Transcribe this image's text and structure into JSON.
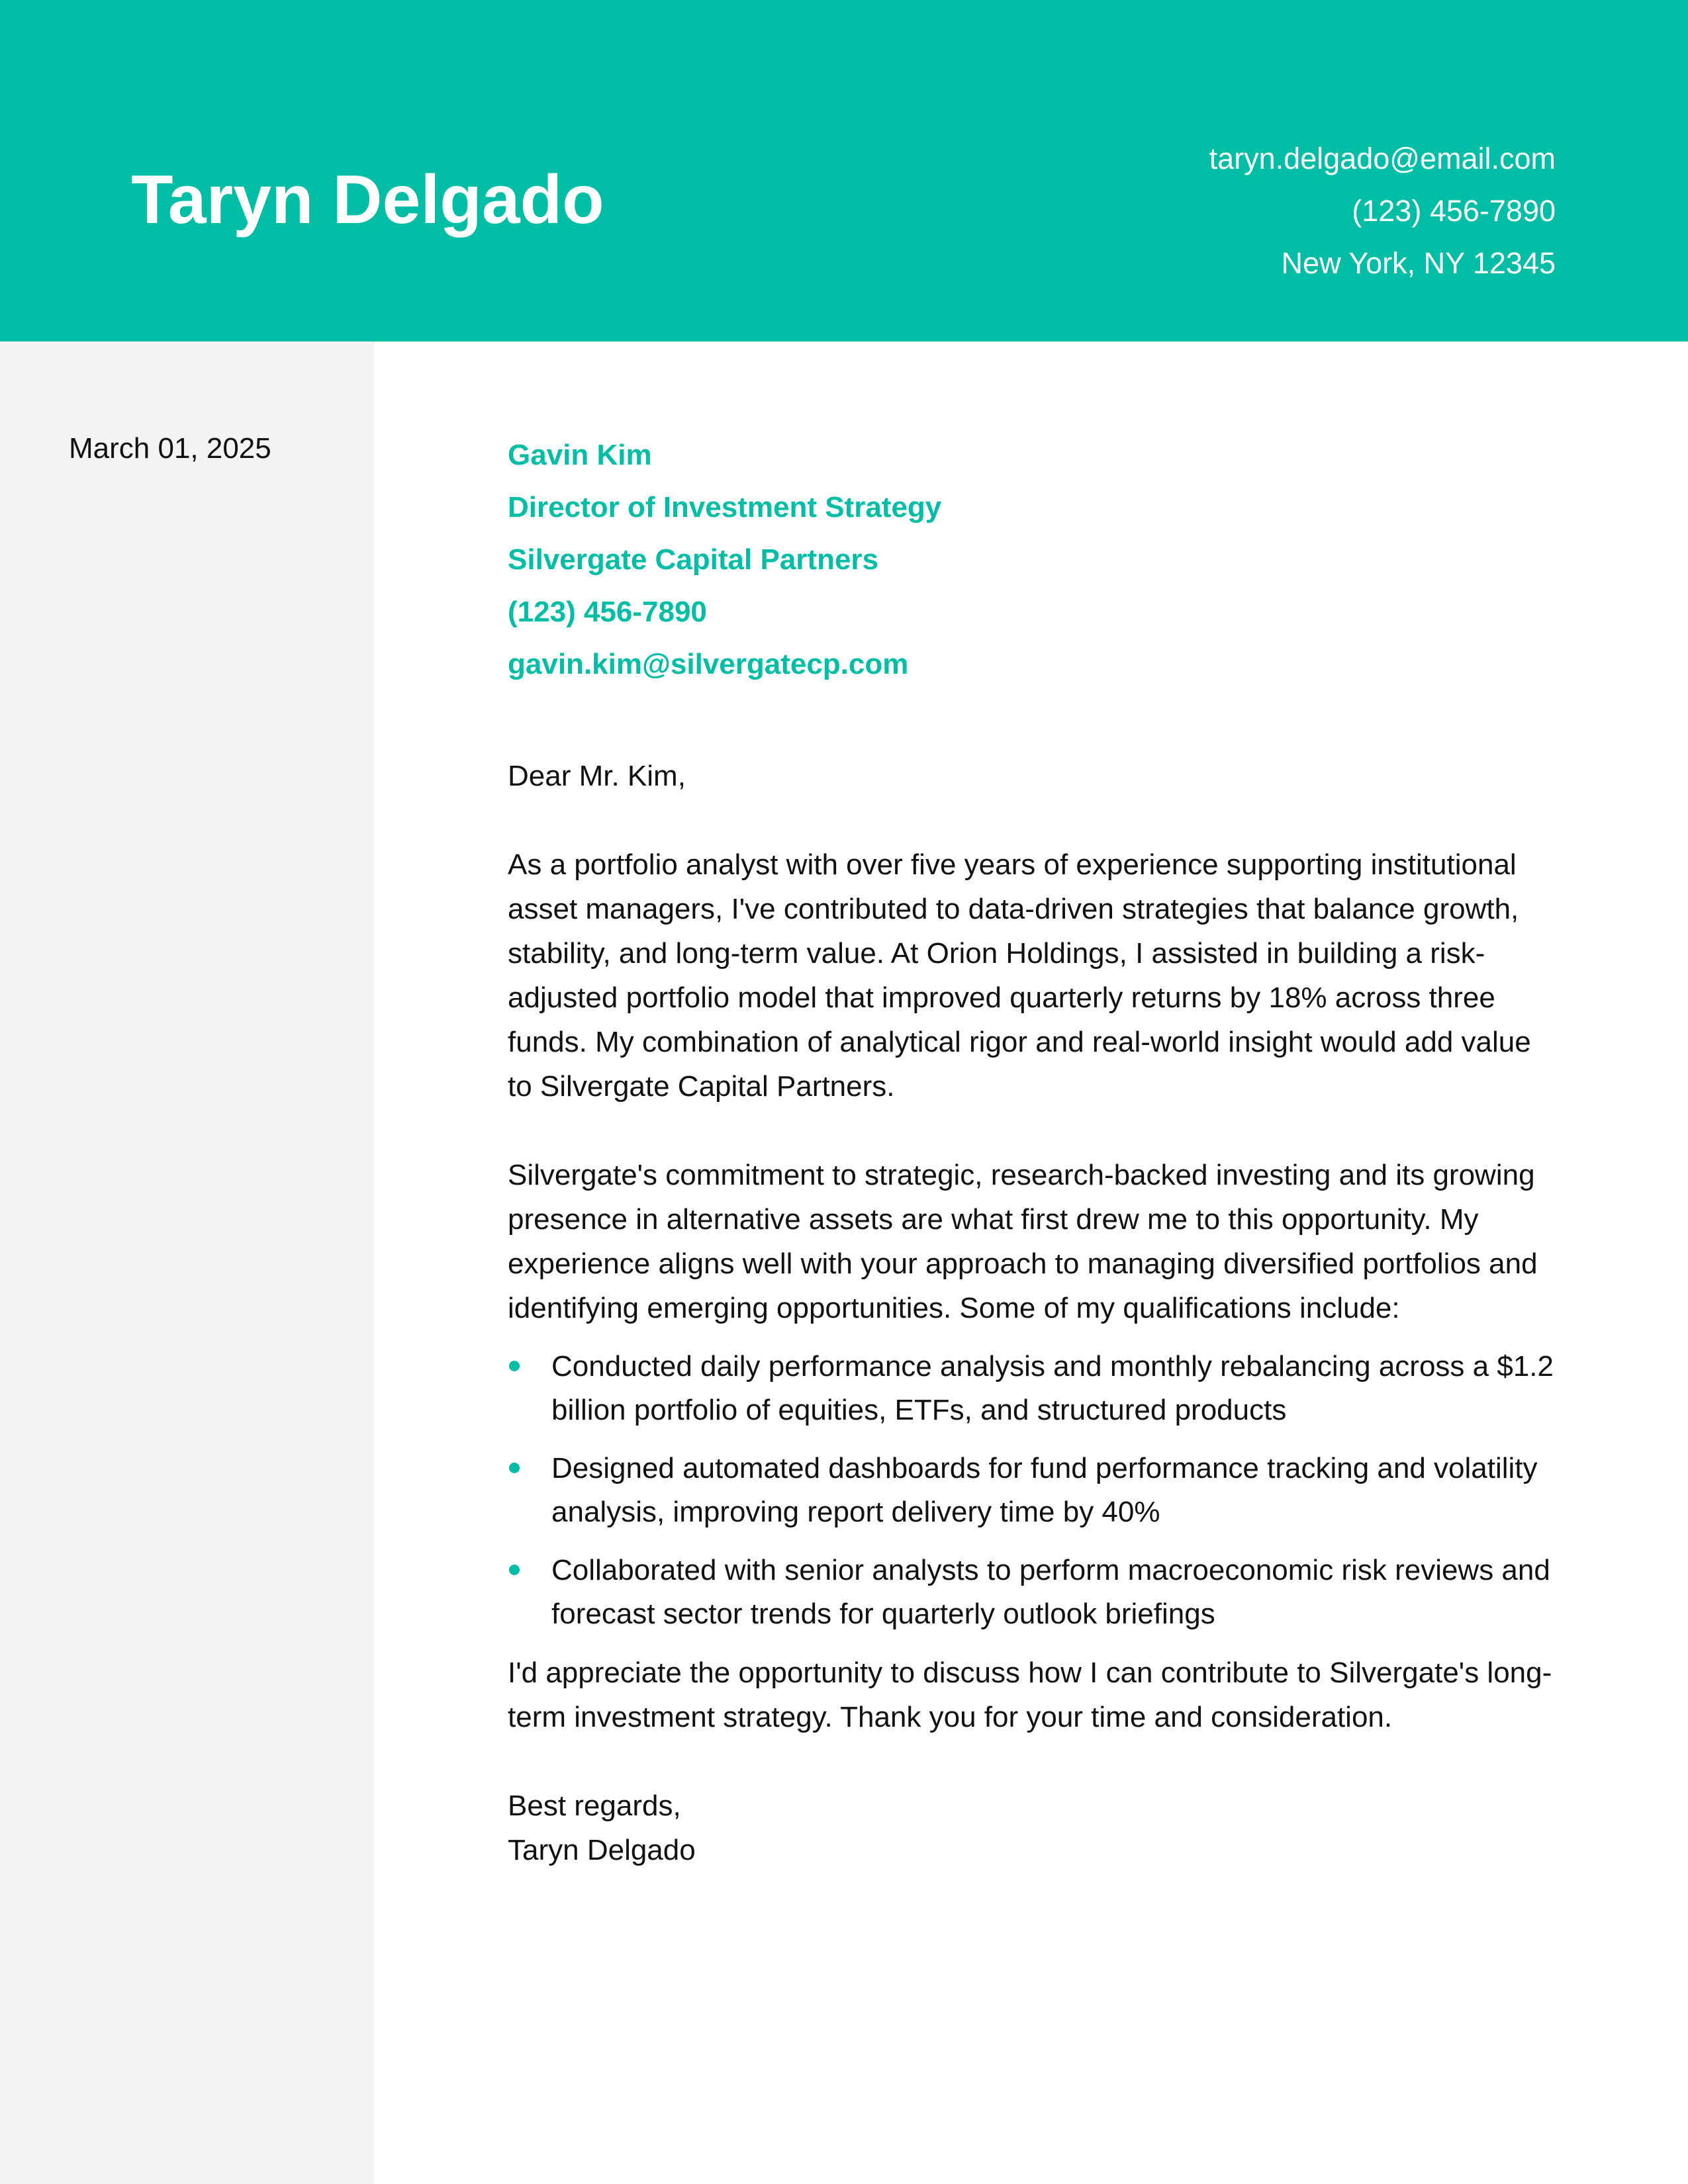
{
  "header": {
    "name": "Taryn Delgado",
    "email": "taryn.delgado@email.com",
    "phone": "(123) 456-7890",
    "location": "New York, NY 12345"
  },
  "sidebar": {
    "date": "March 01, 2025"
  },
  "recipient": {
    "name": "Gavin Kim",
    "title": "Director of Investment Strategy",
    "company": "Silvergate Capital Partners",
    "phone": "(123) 456-7890",
    "email": "gavin.kim@silvergatecp.com"
  },
  "letter": {
    "salutation": "Dear Mr. Kim,",
    "paragraph_1": "As a portfolio analyst with over five years of experience supporting institutional asset managers, I've contributed to data-driven strategies that balance growth, stability, and long-term value. At Orion Holdings, I assisted in building a risk-adjusted portfolio model that improved quarterly returns by 18% across three funds. My combination of analytical rigor and real-world insight would add value to Silvergate Capital Partners.",
    "paragraph_2": "Silvergate's commitment to strategic, research-backed investing and its growing presence in alternative assets are what first drew me to this opportunity. My experience aligns well with your approach to managing diversified portfolios and identifying emerging opportunities. Some of my qualifications include:",
    "bullets": [
      "Conducted daily performance analysis and monthly rebalancing across a $1.2 billion portfolio of equities, ETFs, and structured products",
      "Designed automated dashboards for fund performance tracking and volatility analysis, improving report delivery time by 40%",
      "Collaborated with senior analysts to perform macroeconomic risk reviews and forecast sector trends for quarterly outlook briefings"
    ],
    "closing_paragraph": "I'd appreciate the opportunity to discuss how I can contribute to Silvergate's long-term investment strategy. Thank you for your time and consideration.",
    "signoff": "Best regards,",
    "signature": "Taryn Delgado"
  },
  "colors": {
    "accent": "#00bda5",
    "sidebar_bg": "#f4f4f4",
    "text": "#111111"
  }
}
